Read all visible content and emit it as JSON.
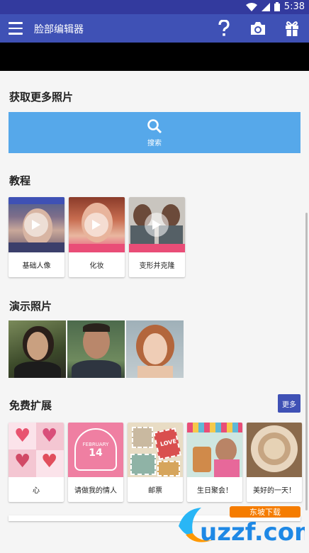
{
  "statusbar": {
    "time": "5:38"
  },
  "appbar": {
    "title": "脸部编辑器"
  },
  "sections": {
    "get_more": "获取更多照片",
    "tutorials": "教程",
    "demos": "演示照片",
    "free_ext": "免费扩展"
  },
  "search": {
    "label": "搜索"
  },
  "tutorials": [
    {
      "label": "基础人像"
    },
    {
      "label": "化妆"
    },
    {
      "label": "变形并克隆"
    }
  ],
  "extensions": [
    {
      "label": "心"
    },
    {
      "label": "请做我的情人"
    },
    {
      "label": "邮票"
    },
    {
      "label": "生日聚会！"
    },
    {
      "label": "美好的一天！"
    }
  ],
  "more_label": "更多",
  "ext_thumb_text": {
    "feb": "FEBRUARY",
    "day": "14",
    "love": "LOVE"
  },
  "watermark": {
    "text": "uzzf.com",
    "banner": "东坡下载"
  },
  "colors": {
    "primary": "#3f51b5",
    "status": "#333a9e",
    "search": "#56a8ea"
  }
}
